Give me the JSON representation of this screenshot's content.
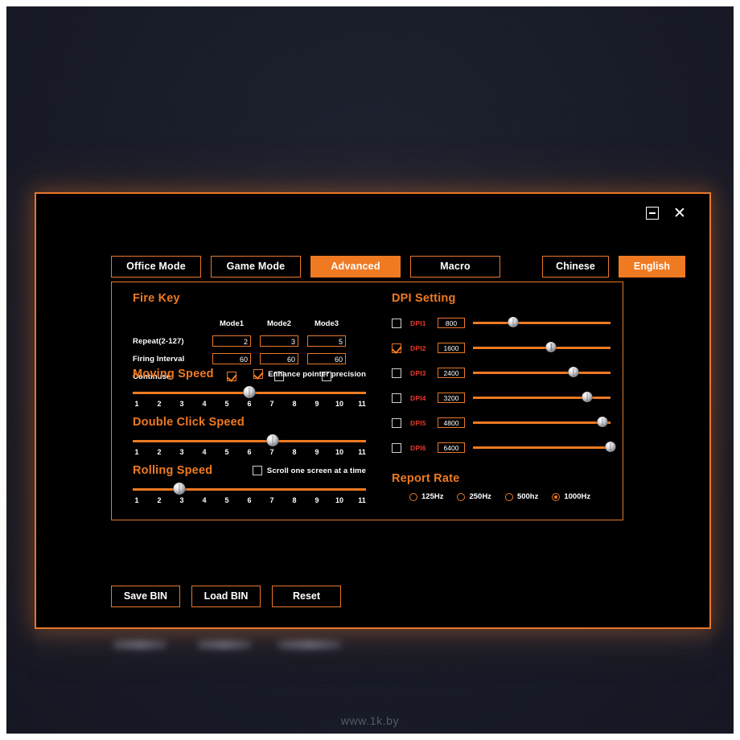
{
  "window": {
    "minimize_label": "–",
    "close_label": "✕"
  },
  "tabs": [
    {
      "label": "Office Mode",
      "active": false
    },
    {
      "label": "Game Mode",
      "active": false
    },
    {
      "label": "Advanced",
      "active": true
    },
    {
      "label": "Macro",
      "active": false
    }
  ],
  "language": [
    {
      "label": "Chinese",
      "active": false
    },
    {
      "label": "English",
      "active": true
    }
  ],
  "fire_key": {
    "title": "Fire Key",
    "column_headers": [
      "Mode1",
      "Mode2",
      "Mode3"
    ],
    "rows": [
      {
        "label": "Repeat(2-127)",
        "type": "input",
        "values": [
          "2",
          "3",
          "5"
        ]
      },
      {
        "label": "Firing Interval",
        "type": "input",
        "values": [
          "60",
          "60",
          "60"
        ]
      },
      {
        "label": "Continuse",
        "type": "checkbox",
        "checked": [
          true,
          false,
          false
        ]
      }
    ]
  },
  "moving_speed": {
    "title": "Moving Speed",
    "option_label": "Enhance pointer precision",
    "option_checked": true,
    "ticks": [
      "1",
      "2",
      "3",
      "4",
      "5",
      "6",
      "7",
      "8",
      "9",
      "10",
      "11"
    ],
    "value": 6
  },
  "double_click_speed": {
    "title": "Double Click Speed",
    "ticks": [
      "1",
      "2",
      "3",
      "4",
      "5",
      "6",
      "7",
      "8",
      "9",
      "10",
      "11"
    ],
    "value": 7
  },
  "rolling_speed": {
    "title": "Rolling Speed",
    "option_label": "Scroll one screen at a time",
    "option_checked": false,
    "ticks": [
      "1",
      "2",
      "3",
      "4",
      "5",
      "6",
      "7",
      "8",
      "9",
      "10",
      "11"
    ],
    "value": 3
  },
  "dpi_setting": {
    "title": "DPI Setting",
    "rows": [
      {
        "label": "DPI1",
        "value": "800",
        "checked": false,
        "slider_percent": 29
      },
      {
        "label": "DPI2",
        "value": "1600",
        "checked": true,
        "slider_percent": 57
      },
      {
        "label": "DPI3",
        "value": "2400",
        "checked": false,
        "slider_percent": 73
      },
      {
        "label": "DPI4",
        "value": "3200",
        "checked": false,
        "slider_percent": 83
      },
      {
        "label": "DPI5",
        "value": "4800",
        "checked": false,
        "slider_percent": 94
      },
      {
        "label": "DPI6",
        "value": "6400",
        "checked": false,
        "slider_percent": 100
      }
    ]
  },
  "report_rate": {
    "title": "Report Rate",
    "options": [
      {
        "label": "125Hz",
        "selected": false
      },
      {
        "label": "250Hz",
        "selected": false
      },
      {
        "label": "500hz",
        "selected": false
      },
      {
        "label": "1000Hz",
        "selected": true
      }
    ]
  },
  "bottom_buttons": [
    {
      "label": "Save BIN"
    },
    {
      "label": "Load BIN"
    },
    {
      "label": "Reset"
    }
  ],
  "watermark": "www.1k.by",
  "colors": {
    "accent": "#ef7a22",
    "border": "#e8772a",
    "dpi_label": "#e8382a",
    "panel_bg": "#000000",
    "page_bg": "#171a27"
  }
}
